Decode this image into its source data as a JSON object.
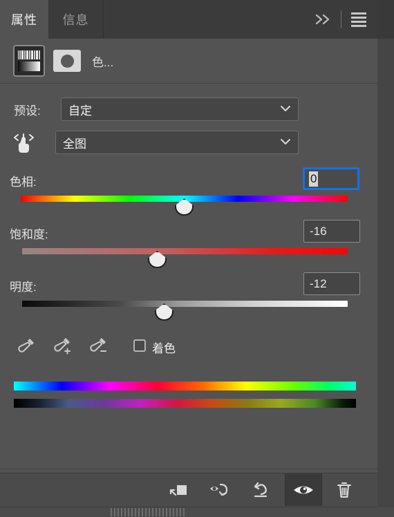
{
  "window": {
    "tabs": [
      {
        "label": "属性",
        "active": true
      },
      {
        "label": "信息",
        "active": false
      }
    ],
    "collapse_icon": "double-chevron-right-icon",
    "menu_icon": "hamburger-menu-icon"
  },
  "layer_row": {
    "adjustment_thumb_icon": "hue-saturation-adjustment-thumbnail",
    "mask_thumb_icon": "layer-mask-thumbnail",
    "label": "色..."
  },
  "preset": {
    "label": "预设:",
    "value": "自定",
    "caret_icon": "chevron-down-icon"
  },
  "range": {
    "hand_icon": "scrubby-slider-hand-icon",
    "value": "全图",
    "caret_icon": "chevron-down-icon"
  },
  "sliders": [
    {
      "name": "hue",
      "label": "色相:",
      "value": "0",
      "value_number": 0,
      "min": -180,
      "max": 180,
      "focused": true,
      "thumb_x_pct": 50
    },
    {
      "name": "saturation",
      "label": "饱和度:",
      "value": "-16",
      "value_number": -16,
      "min": -100,
      "max": 100,
      "focused": false,
      "thumb_x_pct": 42
    },
    {
      "name": "lightness",
      "label": "明度:",
      "value": "-12",
      "value_number": -12,
      "min": -100,
      "max": 100,
      "focused": false,
      "thumb_x_pct": 44
    }
  ],
  "tools": {
    "eyedropper_icon": "eyedropper-icon",
    "eyedropper_add_icon": "eyedropper-add-icon",
    "eyedropper_subtract_icon": "eyedropper-subtract-icon",
    "colorize_label": "着色",
    "colorize_checked": false
  },
  "spectrum": {
    "top_bar_name": "source-color-spectrum-bar",
    "bottom_bar_name": "result-color-spectrum-bar"
  },
  "footer": {
    "buttons": [
      {
        "name": "clip-to-layer-button",
        "icon": "clip-to-layer-icon",
        "active": false
      },
      {
        "name": "toggle-previous-state-button",
        "icon": "eye-with-arrow-icon",
        "active": false
      },
      {
        "name": "reset-button",
        "icon": "reset-arrow-icon",
        "active": false
      },
      {
        "name": "toggle-visibility-button",
        "icon": "eye-icon",
        "active": true
      },
      {
        "name": "delete-layer-button",
        "icon": "trash-icon",
        "active": false
      }
    ]
  },
  "colors": {
    "panel_bg": "#535353",
    "tab_bg": "#3b3b3b",
    "focus_blue": "#1473e6",
    "field_bg": "#454545",
    "text": "#f0f0f0"
  }
}
